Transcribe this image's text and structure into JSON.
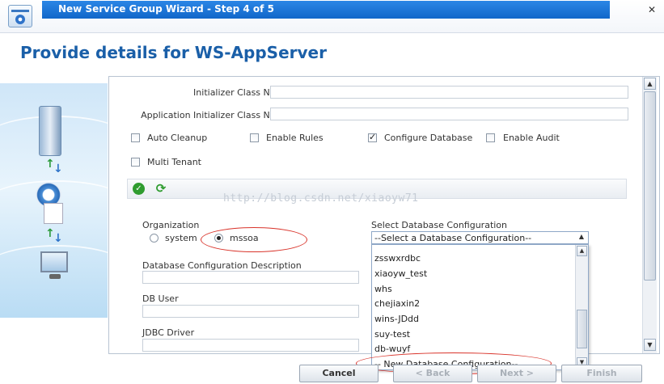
{
  "window": {
    "title": "New Service Group Wizard - Step 4 of 5"
  },
  "page": {
    "title": "Provide details for WS-AppServer"
  },
  "fields": {
    "initializer_label": "Initializer Class Name",
    "initializer_value": "",
    "app_initializer_label": "Application Initializer Class Name",
    "app_initializer_value": ""
  },
  "checkboxes": [
    {
      "label": "Auto Cleanup",
      "checked": false
    },
    {
      "label": "Enable Rules",
      "checked": false
    },
    {
      "label": "Configure Database",
      "checked": true
    },
    {
      "label": "Enable Audit",
      "checked": false
    },
    {
      "label": "Multi Tenant",
      "checked": false
    }
  ],
  "watermark": "http://blog.csdn.net/xiaoyw71",
  "organization": {
    "label": "Organization",
    "options": [
      {
        "label": "system",
        "selected": false
      },
      {
        "label": "mssoa",
        "selected": true
      }
    ]
  },
  "db_desc_label": "Database Configuration Description",
  "db_user_label": "DB User",
  "jdbc_label": "JDBC Driver",
  "db_config": {
    "label": "Select Database Configuration",
    "selected": "--Select a Database Configuration--",
    "options": [
      "zsswxrdbc",
      "xiaoyw_test",
      "whs",
      "chejiaxin2",
      "wins-JDdd",
      "suy-test",
      "db-wuyf",
      "-- New Database Configuration--"
    ]
  },
  "buttons": {
    "cancel": "Cancel",
    "back": "< Back",
    "next": "Next >",
    "finish": "Finish"
  },
  "colors": {
    "annotation_ellipse": "#d9342b",
    "title_bar": "#1167c9",
    "heading": "#1a5fa8"
  }
}
